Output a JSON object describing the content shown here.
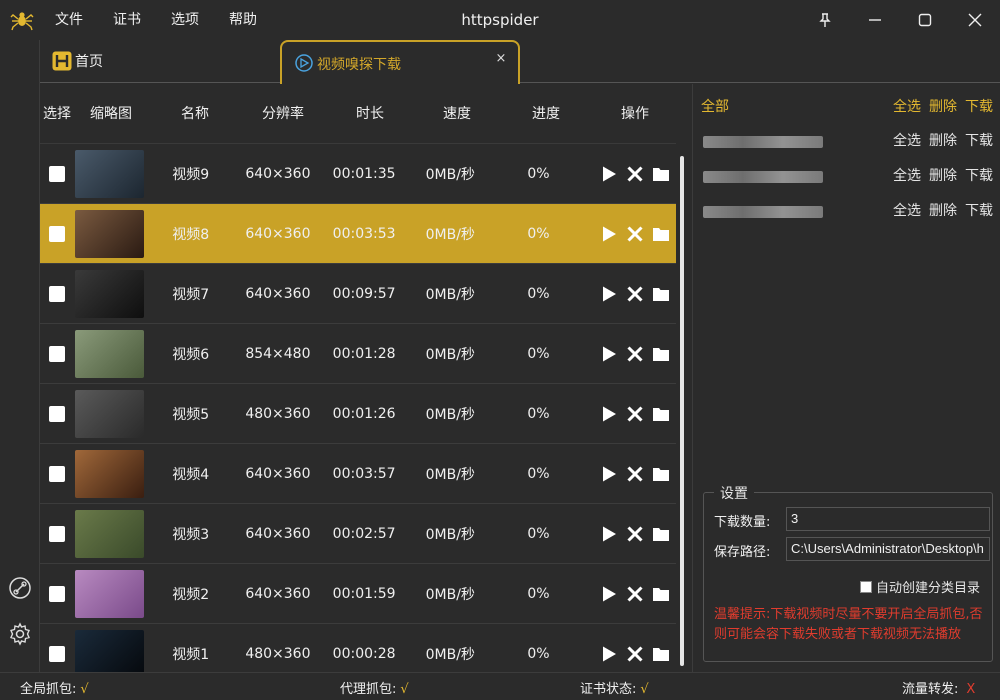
{
  "app": {
    "title": "httpspider",
    "logo_icon": "spider-icon"
  },
  "menu": [
    "文件",
    "证书",
    "选项",
    "帮助"
  ],
  "tabs": {
    "home": "首页",
    "active": "视频嗅探下载",
    "close": "×"
  },
  "table": {
    "headers": [
      "选择",
      "缩略图",
      "名称",
      "分辨率",
      "时长",
      "速度",
      "进度",
      "操作"
    ],
    "rows": [
      {
        "name": "视频9",
        "resolution": "640×360",
        "duration": "00:01:35",
        "speed": "0MB/秒",
        "progress": "0%"
      },
      {
        "name": "视频8",
        "resolution": "640×360",
        "duration": "00:03:53",
        "speed": "0MB/秒",
        "progress": "0%"
      },
      {
        "name": "视频7",
        "resolution": "640×360",
        "duration": "00:09:57",
        "speed": "0MB/秒",
        "progress": "0%"
      },
      {
        "name": "视频6",
        "resolution": "854×480",
        "duration": "00:01:28",
        "speed": "0MB/秒",
        "progress": "0%"
      },
      {
        "name": "视频5",
        "resolution": "480×360",
        "duration": "00:01:26",
        "speed": "0MB/秒",
        "progress": "0%"
      },
      {
        "name": "视频4",
        "resolution": "640×360",
        "duration": "00:03:57",
        "speed": "0MB/秒",
        "progress": "0%"
      },
      {
        "name": "视频3",
        "resolution": "640×360",
        "duration": "00:02:57",
        "speed": "0MB/秒",
        "progress": "0%"
      },
      {
        "name": "视频2",
        "resolution": "640×360",
        "duration": "00:01:59",
        "speed": "0MB/秒",
        "progress": "0%"
      },
      {
        "name": "视频1",
        "resolution": "480×360",
        "duration": "00:00:28",
        "speed": "0MB/秒",
        "progress": "0%"
      }
    ],
    "selected_row": "视频8"
  },
  "right_panel": {
    "all_label": "全部",
    "select_all": "全选",
    "delete": "删除",
    "download": "下载"
  },
  "settings": {
    "legend": "设置",
    "count_label": "下载数量:",
    "count_value": "3",
    "path_label": "保存路径:",
    "path_value": "C:\\Users\\Administrator\\Desktop\\h",
    "auto_label": "自动创建分类目录",
    "tip": "温馨提示:下载视频时尽量不要开启全局抓包,否则可能会容下载失败或者下载视频无法播放"
  },
  "status": {
    "global_capture": "全局抓包:",
    "global_capture_value": "√",
    "proxy_capture": "代理抓包:",
    "proxy_capture_value": "√",
    "cert_status": "证书状态:",
    "cert_status_value": "√",
    "traffic_forward": "流量转发:",
    "traffic_forward_value": "X"
  },
  "colors": {
    "accent": "#c9a227",
    "bg": "#2b2b2b",
    "danger": "#e03c2e"
  }
}
